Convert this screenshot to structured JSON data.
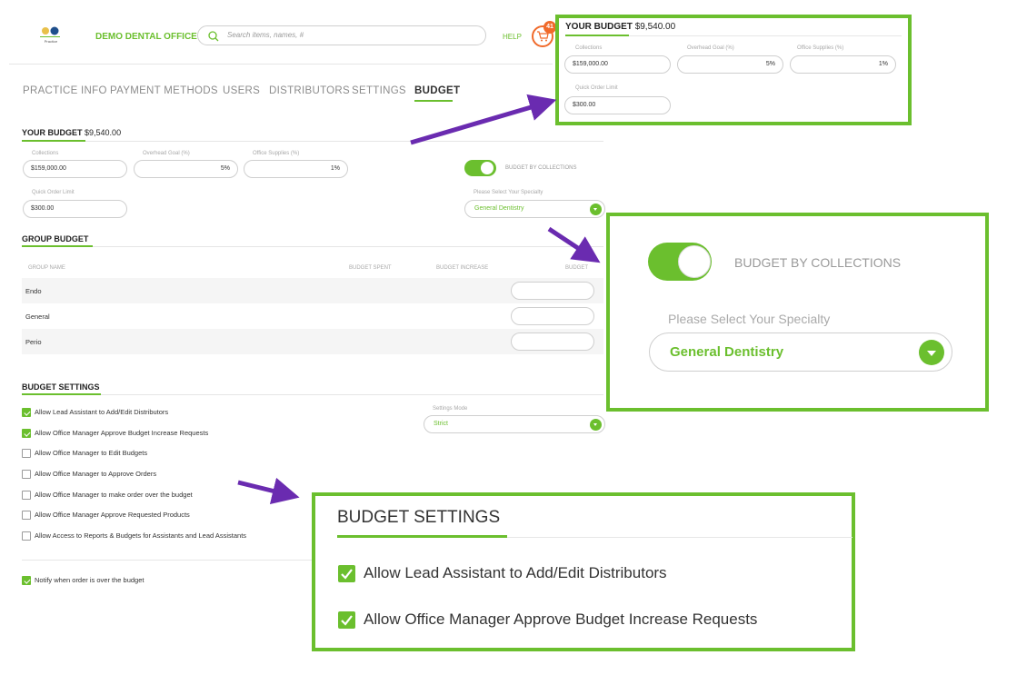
{
  "header": {
    "logo_text": "Practice",
    "office_name": "DEMO DENTAL OFFICE",
    "search_placeholder": "Search items, names, #",
    "help_label": "HELP",
    "cart_count": "41"
  },
  "tabs": [
    {
      "label": "PRACTICE INFO"
    },
    {
      "label": "PAYMENT METHODS"
    },
    {
      "label": "USERS"
    },
    {
      "label": "DISTRIBUTORS"
    },
    {
      "label": "SETTINGS"
    },
    {
      "label": "BUDGET"
    }
  ],
  "your_budget": {
    "title": "YOUR BUDGET",
    "amount": "$9,540.00",
    "collections_label": "Collections",
    "collections_value": "$159,000.00",
    "overhead_label": "Overhead Goal (%)",
    "overhead_value": "5%",
    "supplies_label": "Office Supplies (%)",
    "supplies_value": "1%",
    "quick_limit_label": "Quick Order Limit",
    "quick_limit_value": "$300.00",
    "toggle_label": "BUDGET BY COLLECTIONS",
    "toggle_on": true,
    "specialty_label": "Please Select Your Specialty",
    "specialty_value": "General Dentistry"
  },
  "group_budget": {
    "title": "GROUP BUDGET",
    "columns": [
      "GROUP NAME",
      "BUDGET SPENT",
      "BUDGET INCREASE",
      "BUDGET"
    ],
    "rows": [
      {
        "name": "Endo"
      },
      {
        "name": "General"
      },
      {
        "name": "Perio"
      }
    ]
  },
  "budget_settings": {
    "title": "BUDGET SETTINGS",
    "mode_label": "Settings Mode",
    "mode_value": "Strict",
    "options": [
      {
        "label": "Allow Lead Assistant to Add/Edit Distributors",
        "checked": true
      },
      {
        "label": "Allow Office Manager Approve Budget Increase Requests",
        "checked": true
      },
      {
        "label": "Allow Office Manager to Edit Budgets",
        "checked": false
      },
      {
        "label": "Allow Office Manager to Approve Orders",
        "checked": false
      },
      {
        "label": "Allow Office Manager to make order over the budget",
        "checked": false
      },
      {
        "label": "Allow Office Manager Approve Requested Products",
        "checked": false
      },
      {
        "label": "Allow Access to Reports & Budgets for Assistants and Lead Assistants",
        "checked": false
      }
    ],
    "notify": {
      "label": "Notify when order is over the budget",
      "checked": true
    }
  },
  "colors": {
    "accent": "#6bbf2e",
    "cart": "#f06a2b",
    "arrow": "#6a2bb0"
  },
  "icons": [
    "logo-icon",
    "search-icon",
    "cart-icon",
    "chevron-down-icon",
    "checkmark-icon",
    "arrow-icon"
  ]
}
